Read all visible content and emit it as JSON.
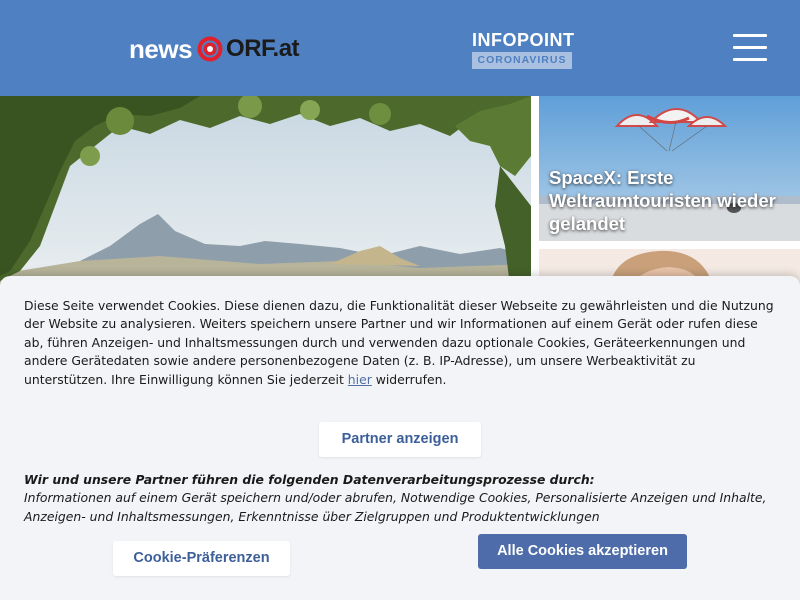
{
  "header": {
    "logo_news": "news",
    "logo_orf": "ORF.at",
    "infopoint_title": "INFOPOINT",
    "infopoint_subtitle": "CORONAVIRUS",
    "menu_icon": "hamburger-icon"
  },
  "stories": [
    {
      "title": "SpaceX: Erste Weltraumtouristen wieder gelandet"
    }
  ],
  "cookie_banner": {
    "text_before_link": "Diese Seite verwendet Cookies. Diese dienen dazu, die Funktionalität dieser Webseite zu gewährleisten und die Nutzung der Website zu analysieren. Weiters speichern unsere Partner und wir Informationen auf einem Gerät oder rufen diese ab, führen Anzeigen- und Inhaltsmessungen durch und verwenden dazu optionale Cookies, Geräteerkennungen und andere Gerätedaten sowie andere personenbezogene Daten (z. B. IP-Adresse), um unsere Werbeaktivität zu unterstützen. Ihre Einwilligung können Sie jederzeit ",
    "link_text": "hier",
    "text_after_link": " widerrufen.",
    "partner_button": "Partner anzeigen",
    "processes_heading": "Wir und unsere Partner führen die folgenden Datenverarbeitungsprozesse durch:",
    "processes_list": "Informationen auf einem Gerät speichern und/oder abrufen, Notwendige Cookies, Personalisierte Anzeigen und Inhalte, Anzeigen- und Inhaltsmessungen, Erkenntnisse über Zielgruppen und Produktentwicklungen",
    "preferences_button": "Cookie-Präferenzen",
    "accept_button": "Alle Cookies akzeptieren"
  },
  "colors": {
    "header_bg": "#4f80c2",
    "banner_bg": "#f2f4f7",
    "primary_button": "#4d6ca9",
    "logo_red": "#e0202c"
  }
}
